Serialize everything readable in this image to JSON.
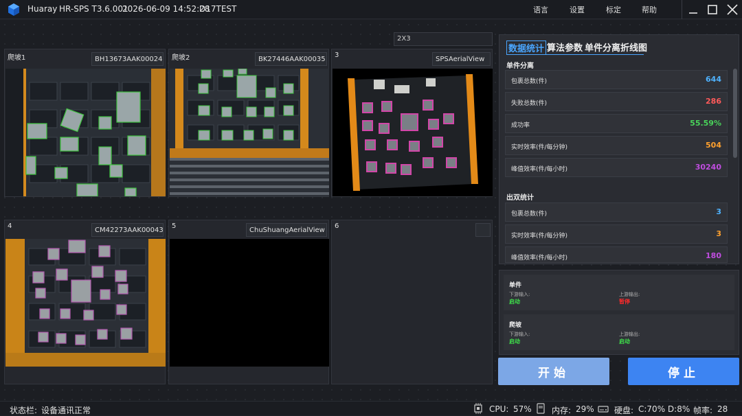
{
  "titlebar": {
    "app_name": "Huaray",
    "version": "HR-SPS T3.6.001",
    "datetime": "2026-06-09 14:52:28",
    "station": "D17TEST",
    "menu": [
      "语言",
      "设置",
      "标定",
      "帮助"
    ]
  },
  "layout_select": "2X3",
  "cameras": [
    {
      "num": "爬坡1",
      "id": "BH13673AAK00024"
    },
    {
      "num": "爬坡2",
      "id": "BK27446AAK00035"
    },
    {
      "num": "3",
      "id": "SPSAerialView"
    },
    {
      "num": "4",
      "id": "CM42273AAK00043"
    },
    {
      "num": "5",
      "id": "ChuShuangAerialView"
    },
    {
      "num": "6",
      "id": ""
    }
  ],
  "tabs": [
    "数据统计",
    "算法参数",
    "单件分离折线图"
  ],
  "single_section": "单件分离",
  "single_stats": [
    {
      "label": "包裹总数(件)",
      "value": "644",
      "color": "#4fb3ff"
    },
    {
      "label": "失败总数(件)",
      "value": "286",
      "color": "#ff5a5a"
    },
    {
      "label": "成功率",
      "value": "55.59%",
      "color": "#49d35a"
    },
    {
      "label": "实时效率(件/每分钟)",
      "value": "504",
      "color": "#ffa12e"
    },
    {
      "label": "峰值效率(件/每小时)",
      "value": "30240",
      "color": "#c04de0"
    }
  ],
  "double_section": "出双统计",
  "double_stats": [
    {
      "label": "包裹总数(件)",
      "value": "3",
      "color": "#4fb3ff"
    },
    {
      "label": "实时效率(件/每分钟)",
      "value": "3",
      "color": "#ffa12e"
    },
    {
      "label": "峰值效率(件/每小时)",
      "value": "180",
      "color": "#c04de0"
    }
  ],
  "io": [
    {
      "title": "单件",
      "in_label": "下游输入:",
      "in_value": "启动",
      "in_color": "#3ee04a",
      "out_label": "上游输出:",
      "out_value": "暂停",
      "out_color": "#ff2a2a"
    },
    {
      "title": "爬坡",
      "in_label": "下游输入:",
      "in_value": "启动",
      "in_color": "#3ee04a",
      "out_label": "上游输出:",
      "out_value": "启动",
      "out_color": "#3ee04a"
    }
  ],
  "buttons": {
    "start": "开始",
    "stop": "停止"
  },
  "status": {
    "label": "状态栏:",
    "message": "设备通讯正常",
    "cpu_label": "CPU:",
    "cpu": "57%",
    "mem_label": "内存:",
    "mem": "29%",
    "disk_label": "硬盘:",
    "disk": "C:70% D:8%",
    "fps_label": "帧率:",
    "fps": "28"
  }
}
